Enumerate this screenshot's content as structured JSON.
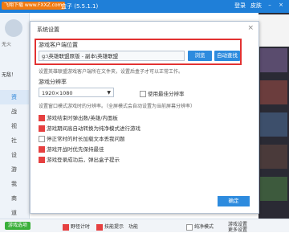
{
  "titlebar": {
    "watermark": "飞翔下载 www.FXXZ.com",
    "app_name": "盒子 (5.5.1.1)",
    "login": "登录",
    "skin": "皮肤"
  },
  "sidebar": {
    "label_top": "无火",
    "status": "无敌！",
    "nav_items": [
      "资",
      "战",
      "视",
      "社",
      "设",
      "游",
      "我",
      "商",
      "道"
    ]
  },
  "dialog": {
    "title": "系统设置",
    "close": "×",
    "path_section_label": "游戏客户端位置",
    "path_value": "g:\\英雄联盟原版 - 副本\\英雄联盟",
    "browse_button": "浏览",
    "auto_find_button": "自动查找",
    "path_hint": "设置英雄联盟游戏客户端所在文件夹，设置后盒子才可以正常工作。",
    "resolution_section_label": "游戏分辨率",
    "resolution_value": "1920×1080",
    "best_resolution_label": "使用最佳分辨率",
    "resolution_hint": "设置窗口模式游戏时的分辨率。（全屏模式会自动设置为当前屏幕分辨率）",
    "options": [
      {
        "label": "游戏结束时弹出数/英雄/内面板",
        "checked": true
      },
      {
        "label": "游戏期间高自动转换为纯净模式进行游戏",
        "checked": true
      },
      {
        "label": "停正常时的时长加载文本丢我问题",
        "checked": false
      },
      {
        "label": "游戏开战时优先保持最佳",
        "checked": true
      },
      {
        "label": "游戏登录成功后，弹出盒子提示",
        "checked": true
      }
    ],
    "ok_button": "确定"
  },
  "bottombar": {
    "green_button": "游戏选项",
    "items": [
      "野怪计时",
      "技能提示",
      "功能",
      "纯净模式",
      "游戏设置",
      "更多设置"
    ]
  }
}
